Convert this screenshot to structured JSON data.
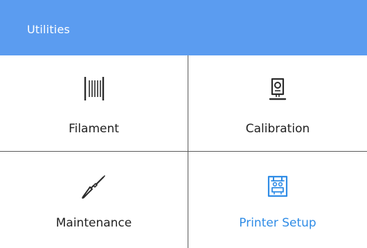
{
  "header": {
    "title": "Utilities"
  },
  "tiles": [
    {
      "label": "Filament",
      "icon": "filament-spool-icon",
      "active": false
    },
    {
      "label": "Calibration",
      "icon": "calibration-printer-icon",
      "active": false
    },
    {
      "label": "Maintenance",
      "icon": "screwdriver-icon",
      "active": false
    },
    {
      "label": "Printer Setup",
      "icon": "printer-setup-icon",
      "active": true
    }
  ],
  "colors": {
    "header_background": "#5b9cf0",
    "header_text": "#ffffff",
    "label_text": "#222222",
    "active_accent": "#2f8ce6",
    "divider": "#5a5a5a"
  }
}
